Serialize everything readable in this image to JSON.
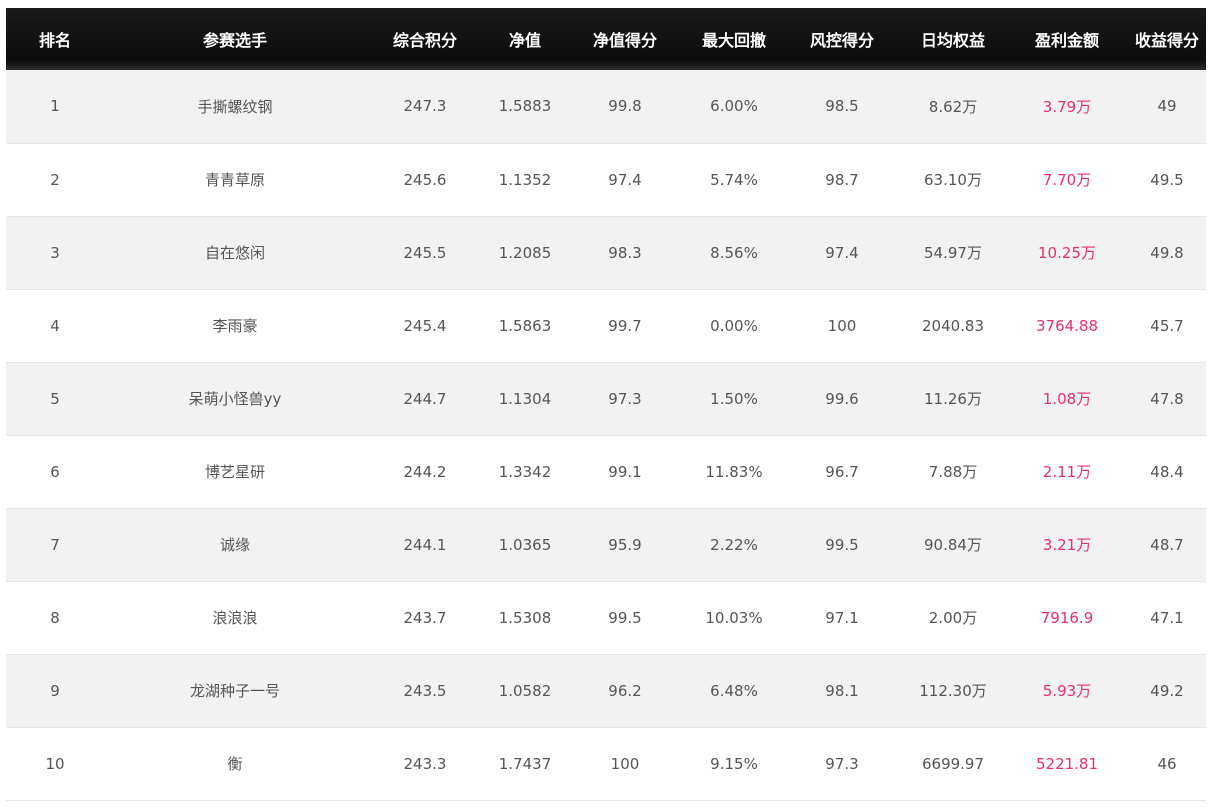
{
  "table": {
    "headers": [
      "排名",
      "参赛选手",
      "综合积分",
      "净值",
      "净值得分",
      "最大回撤",
      "风控得分",
      "日均权益",
      "盈利金额",
      "收益得分"
    ],
    "rows": [
      [
        "1",
        "手撕螺纹钢",
        "247.3",
        "1.5883",
        "99.8",
        "6.00%",
        "98.5",
        "8.62万",
        "3.79万",
        "49"
      ],
      [
        "2",
        "青青草原",
        "245.6",
        "1.1352",
        "97.4",
        "5.74%",
        "98.7",
        "63.10万",
        "7.70万",
        "49.5"
      ],
      [
        "3",
        "自在悠闲",
        "245.5",
        "1.2085",
        "98.3",
        "8.56%",
        "97.4",
        "54.97万",
        "10.25万",
        "49.8"
      ],
      [
        "4",
        "李雨豪",
        "245.4",
        "1.5863",
        "99.7",
        "0.00%",
        "100",
        "2040.83",
        "3764.88",
        "45.7"
      ],
      [
        "5",
        "呆萌小怪兽yy",
        "244.7",
        "1.1304",
        "97.3",
        "1.50%",
        "99.6",
        "11.26万",
        "1.08万",
        "47.8"
      ],
      [
        "6",
        "博艺星研",
        "244.2",
        "1.3342",
        "99.1",
        "11.83%",
        "96.7",
        "7.88万",
        "2.11万",
        "48.4"
      ],
      [
        "7",
        "诚缘",
        "244.1",
        "1.0365",
        "95.9",
        "2.22%",
        "99.5",
        "90.84万",
        "3.21万",
        "48.7"
      ],
      [
        "8",
        "浪浪浪",
        "243.7",
        "1.5308",
        "99.5",
        "10.03%",
        "97.1",
        "2.00万",
        "7916.9",
        "47.1"
      ],
      [
        "9",
        "龙湖种子一号",
        "243.5",
        "1.0582",
        "96.2",
        "6.48%",
        "98.1",
        "112.30万",
        "5.93万",
        "49.2"
      ],
      [
        "10",
        "衡",
        "243.3",
        "1.7437",
        "100",
        "9.15%",
        "97.3",
        "6699.97",
        "5221.81",
        "46"
      ]
    ]
  },
  "colors": {
    "header_bg": "#111111",
    "header_text": "#ffffff",
    "row_odd": "#f2f2f2",
    "row_even": "#ffffff",
    "cell_text": "#555555",
    "profit_text": "#e8306f"
  }
}
